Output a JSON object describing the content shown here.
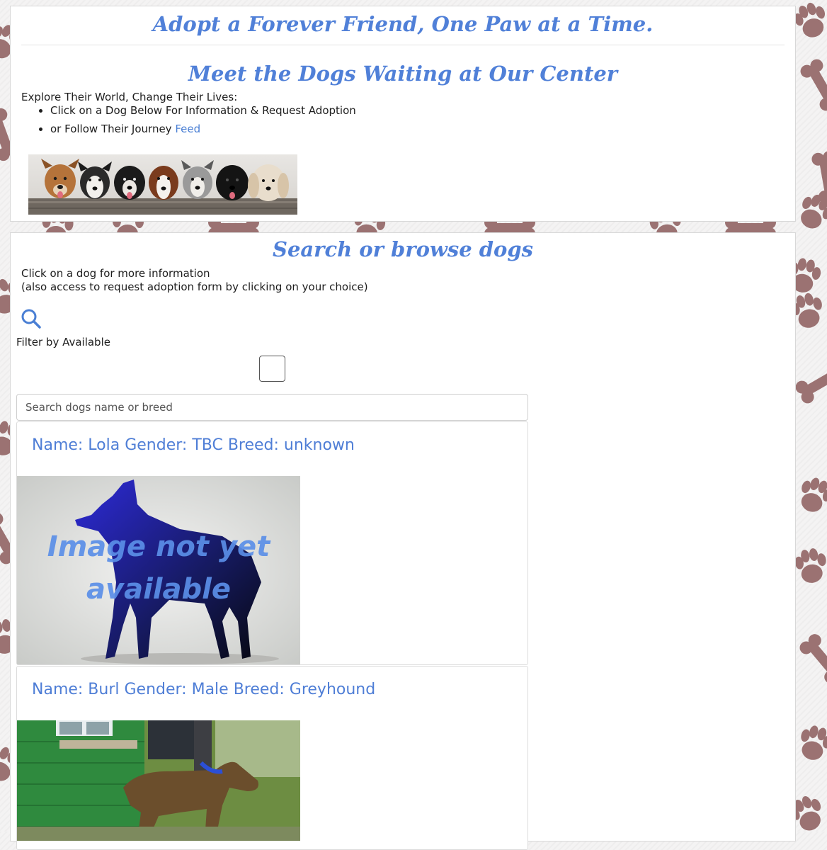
{
  "intro": {
    "title": "Adopt a Forever Friend, One Paw at a Time.",
    "subtitle": "Meet the Dogs Waiting at Our Center",
    "lead": "Explore Their World, Change Their Lives:",
    "bullets": {
      "first": "Click on a Dog Below For Information & Request Adoption",
      "second_prefix": "or Follow Their Journey",
      "feed_link": "Feed"
    }
  },
  "search": {
    "title": "Search or browse dogs",
    "instruction_line1": "Click on a dog for more information",
    "instruction_line2": "(also access to request adoption form by clicking on your choice)",
    "filter_label": "Filter by Available",
    "input_placeholder": "Search dogs name or breed",
    "input_value": ""
  },
  "dogs": [
    {
      "title": "Name: Lola Gender: TBC Breed: unknown",
      "image_overlay_line1": "Image not yet",
      "image_overlay_line2": "available"
    },
    {
      "title": "Name: Burl Gender: Male Breed: Greyhound"
    }
  ],
  "colors": {
    "accent": "#5080d8",
    "link": "#4a7fd4",
    "paw": "#9b7272"
  }
}
